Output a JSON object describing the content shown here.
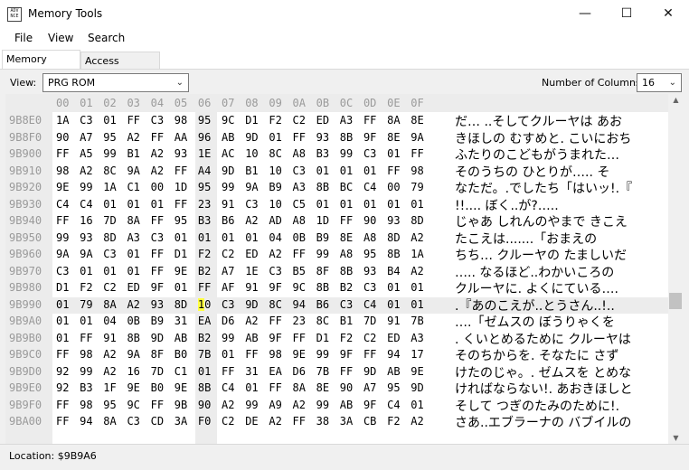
{
  "window": {
    "title": "Memory Tools",
    "icon_text": "ADV NCE",
    "controls": {
      "minimize": "—",
      "maximize": "☐",
      "close": "✕"
    }
  },
  "menu": [
    "File",
    "View",
    "Search"
  ],
  "tabs": [
    {
      "label": "Memory Viewer",
      "active": true
    },
    {
      "label": "Access Counters",
      "active": false
    }
  ],
  "toolbar": {
    "view_label": "View:",
    "view_value": "PRG ROM",
    "columns_label": "Number of Columns:",
    "columns_value": "16"
  },
  "hex": {
    "header": [
      "00",
      "01",
      "02",
      "03",
      "04",
      "05",
      "06",
      "07",
      "08",
      "09",
      "0A",
      "0B",
      "0C",
      "0D",
      "0E",
      "0F"
    ],
    "selected": {
      "row": 11,
      "col": 7
    },
    "rows": [
      {
        "addr": "9B8E0",
        "bytes": [
          "1A",
          "C3",
          "01",
          "FF",
          "C3",
          "98",
          "95",
          "9C",
          "D1",
          "F2",
          "C2",
          "ED",
          "A3",
          "FF",
          "8A",
          "8E"
        ],
        "text": "だ…  ..そしてクルーヤは あお"
      },
      {
        "addr": "9B8F0",
        "bytes": [
          "90",
          "A7",
          "95",
          "A2",
          "FF",
          "AA",
          "96",
          "AB",
          "9D",
          "01",
          "FF",
          "93",
          "8B",
          "9F",
          "8E",
          "9A"
        ],
        "text": "きほしの むすめと. こいにおち"
      },
      {
        "addr": "9B900",
        "bytes": [
          "FF",
          "A5",
          "99",
          "B1",
          "A2",
          "93",
          "1E",
          "AC",
          "10",
          "8C",
          "A8",
          "B3",
          "99",
          "C3",
          "01",
          "FF"
        ],
        "text": " ふたりのこどもがうまれた…"
      },
      {
        "addr": "9B910",
        "bytes": [
          "98",
          "A2",
          "8C",
          "9A",
          "A2",
          "FF",
          "A4",
          "9D",
          "B1",
          "10",
          "C3",
          "01",
          "01",
          "01",
          "FF",
          "98"
        ],
        "text": "そのうちの ひとりが….. そ"
      },
      {
        "addr": "9B920",
        "bytes": [
          "9E",
          "99",
          "1A",
          "C1",
          "00",
          "1D",
          "95",
          "99",
          "9A",
          "B9",
          "A3",
          "8B",
          "BC",
          "C4",
          "00",
          "79"
        ],
        "text": "なただ。.でしたち「はいッ!.『"
      },
      {
        "addr": "9B930",
        "bytes": [
          "C4",
          "C4",
          "01",
          "01",
          "01",
          "FF",
          "23",
          "91",
          "C3",
          "10",
          "C5",
          "01",
          "01",
          "01",
          "01",
          "01"
        ],
        "text": "!!.... ぼく..が?….."
      },
      {
        "addr": "9B940",
        "bytes": [
          "FF",
          "16",
          "7D",
          "8A",
          "FF",
          "95",
          "B3",
          "B6",
          "A2",
          "AD",
          "A8",
          "1D",
          "FF",
          "90",
          "93",
          "8D"
        ],
        "text": "  じゃあ しれんのやまで きこえ"
      },
      {
        "addr": "9B950",
        "bytes": [
          "99",
          "93",
          "8D",
          "A3",
          "C3",
          "01",
          "01",
          "01",
          "01",
          "04",
          "0B",
          "B9",
          "8E",
          "A8",
          "8D",
          "A2"
        ],
        "text": "たこえは.......「おまえの"
      },
      {
        "addr": "9B960",
        "bytes": [
          "9A",
          "9A",
          "C3",
          "01",
          "FF",
          "D1",
          "F2",
          "C2",
          "ED",
          "A2",
          "FF",
          "99",
          "A8",
          "95",
          "8B",
          "1A"
        ],
        "text": "ちち… クルーヤの たましいだ"
      },
      {
        "addr": "9B970",
        "bytes": [
          "C3",
          "01",
          "01",
          "01",
          "FF",
          "9E",
          "B2",
          "A7",
          "1E",
          "C3",
          "B5",
          "8F",
          "8B",
          "93",
          "B4",
          "A2"
        ],
        "text": "…..  なるほど..わかいころの"
      },
      {
        "addr": "9B980",
        "bytes": [
          "D1",
          "F2",
          "C2",
          "ED",
          "9F",
          "01",
          "FF",
          "AF",
          "91",
          "9F",
          "9C",
          "8B",
          "B2",
          "C3",
          "01",
          "01"
        ],
        "text": "クルーヤに. よくにている…."
      },
      {
        "addr": "9B990",
        "bytes": [
          "01",
          "79",
          "8A",
          "A2",
          "93",
          "8D",
          "10",
          "C3",
          "9D",
          "8C",
          "94",
          "B6",
          "C3",
          "C4",
          "01",
          "01"
        ],
        "text": ".『あのこえが..とうさん..!.."
      },
      {
        "addr": "9B9A0",
        "bytes": [
          "01",
          "01",
          "04",
          "0B",
          "B9",
          "31",
          "EA",
          "D6",
          "A2",
          "FF",
          "23",
          "8C",
          "B1",
          "7D",
          "91",
          "7B"
        ],
        "text": "….「ゼムスの ぼうりゃくを"
      },
      {
        "addr": "9B9B0",
        "bytes": [
          "01",
          "FF",
          "91",
          "8B",
          "9D",
          "AB",
          "B2",
          "99",
          "AB",
          "9F",
          "FF",
          "D1",
          "F2",
          "C2",
          "ED",
          "A3"
        ],
        "text": ". くいとめるために クルーヤは"
      },
      {
        "addr": "9B9C0",
        "bytes": [
          "FF",
          "98",
          "A2",
          "9A",
          "8F",
          "B0",
          "7B",
          "01",
          "FF",
          "98",
          "9E",
          "99",
          "9F",
          "FF",
          "94",
          "17"
        ],
        "text": " そのちからを. そなたに さず"
      },
      {
        "addr": "9B9D0",
        "bytes": [
          "92",
          "99",
          "A2",
          "16",
          "7D",
          "C1",
          "01",
          "FF",
          "31",
          "EA",
          "D6",
          "7B",
          "FF",
          "9D",
          "AB",
          "9E"
        ],
        "text": "けたのじゃ。. ゼムスを とめな"
      },
      {
        "addr": "9B9E0",
        "bytes": [
          "92",
          "B3",
          "1F",
          "9E",
          "B0",
          "9E",
          "8B",
          "C4",
          "01",
          "FF",
          "8A",
          "8E",
          "90",
          "A7",
          "95",
          "9D"
        ],
        "text": "ければならない!. あおきほしと"
      },
      {
        "addr": "9B9F0",
        "bytes": [
          "FF",
          "98",
          "95",
          "9C",
          "FF",
          "9B",
          "90",
          "A2",
          "99",
          "A9",
          "A2",
          "99",
          "AB",
          "9F",
          "C4",
          "01"
        ],
        "text": " そして つぎのたみのために!."
      },
      {
        "addr": "9BA00",
        "bytes": [
          "FF",
          "94",
          "8A",
          "C3",
          "CD",
          "3A",
          "F0",
          "C2",
          "DE",
          "A2",
          "FF",
          "38",
          "3A",
          "CB",
          "F2",
          "A2"
        ],
        "text": "さあ..エブラーナの バブイルの"
      }
    ]
  },
  "status": {
    "location": "Location: $9B9A6"
  }
}
